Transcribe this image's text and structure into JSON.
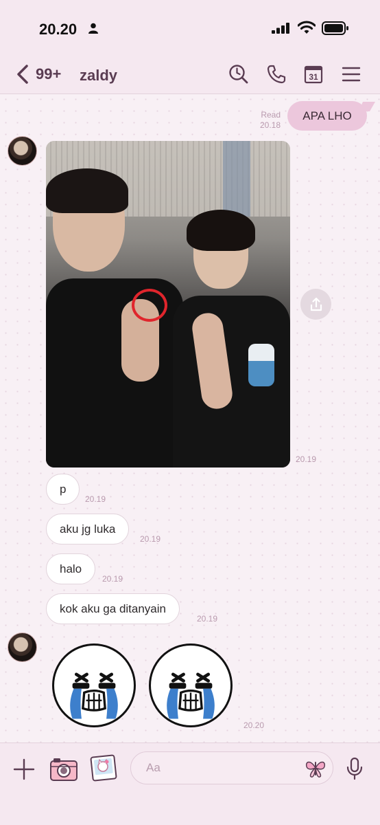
{
  "status_bar": {
    "time": "20.20"
  },
  "header": {
    "unread_count": "99+",
    "chat_name": "zaldy",
    "calendar_day": "31"
  },
  "messages": {
    "outgoing_1": {
      "text": "APA LHO",
      "read_label": "Read",
      "time": "20.18"
    },
    "photo": {
      "time": "20.19"
    },
    "incoming": [
      {
        "text": "p",
        "time": "20.19"
      },
      {
        "text": "aku jg luka",
        "time": "20.19"
      },
      {
        "text": "halo",
        "time": "20.19"
      },
      {
        "text": "kok aku ga ditanyain",
        "time": "20.19"
      }
    ],
    "stickers": {
      "time": "20.20"
    }
  },
  "composer": {
    "placeholder": "Aa"
  },
  "colors": {
    "accent": "#5a3c52",
    "bubble_out": "#ecc7dc",
    "timestamp": "#b99aae",
    "background": "#f8f0f5"
  },
  "icons": [
    "person-icon",
    "signal-icon",
    "wifi-icon",
    "battery-icon",
    "chevron-left-icon",
    "search-icon",
    "phone-icon",
    "calendar-icon",
    "menu-icon",
    "share-icon",
    "plus-icon",
    "camera-icon",
    "gallery-icon",
    "emoji-icon",
    "microphone-icon"
  ]
}
